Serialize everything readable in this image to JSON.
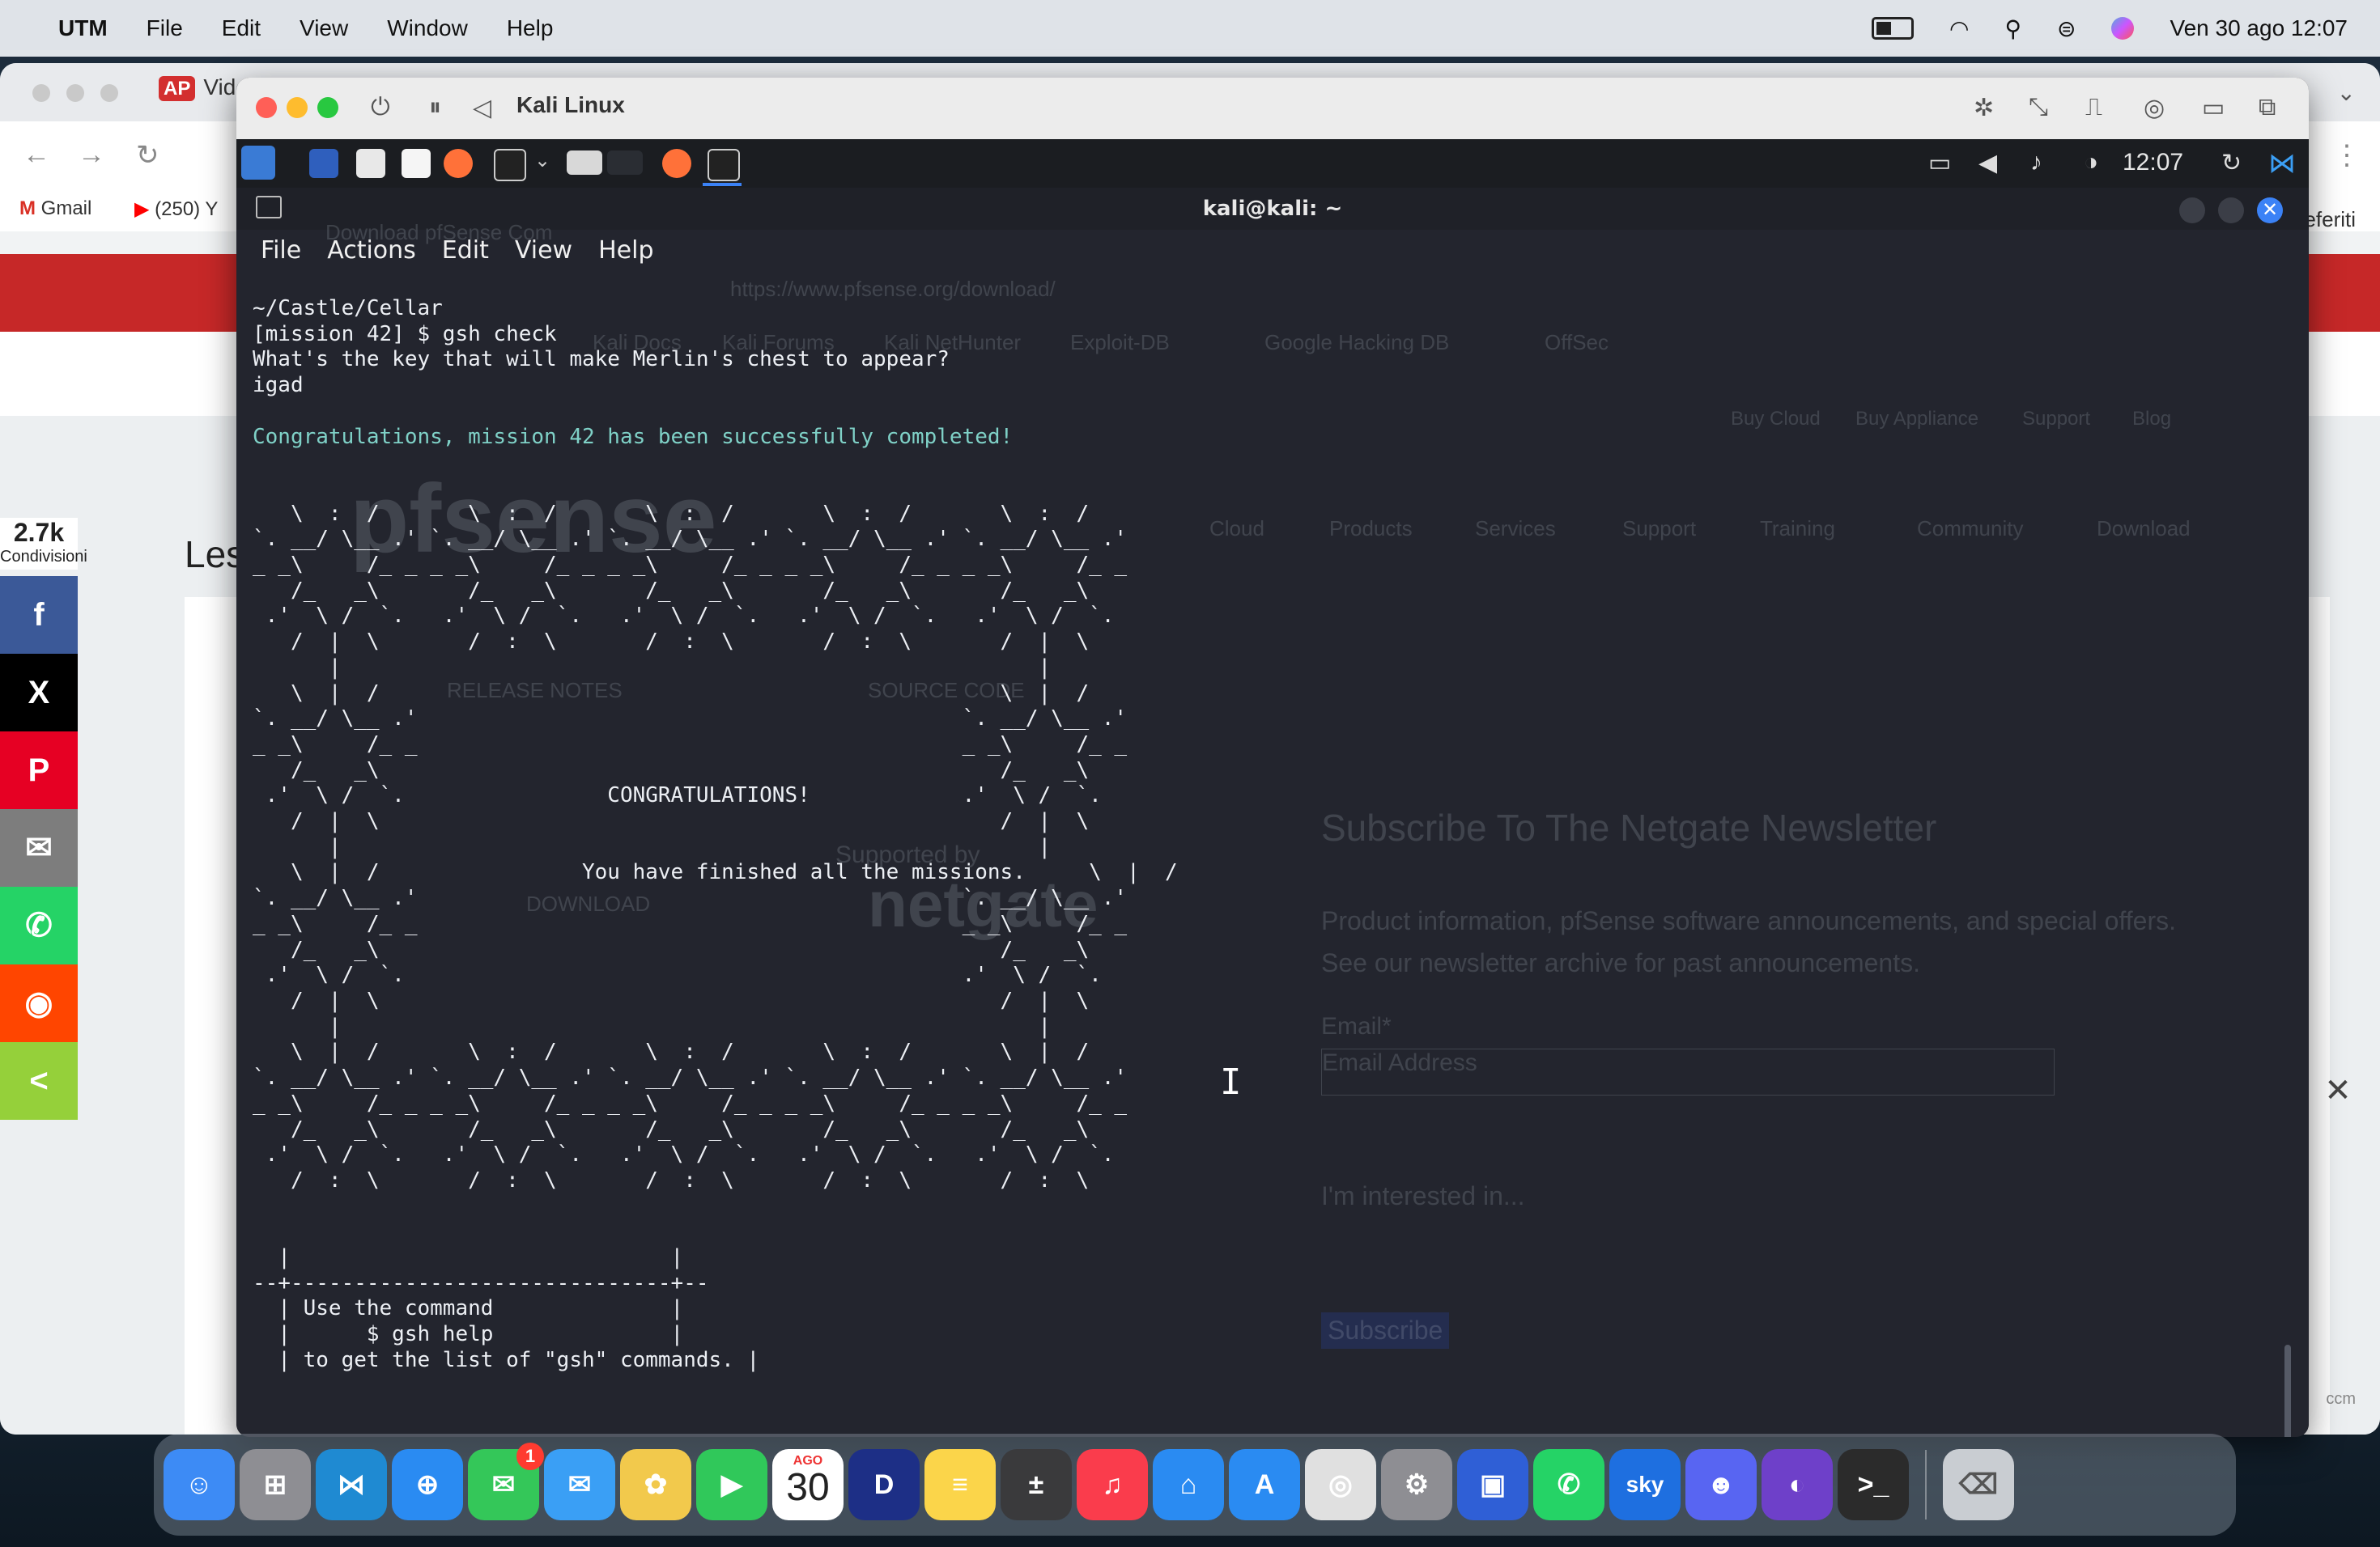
{
  "menubar": {
    "app": "UTM",
    "items": [
      "File",
      "Edit",
      "View",
      "Window",
      "Help"
    ],
    "datetime": "Ven 30 ago 12:07"
  },
  "browser": {
    "tab_title": "Vide",
    "tab_badge": "AP",
    "bookmarks": [
      {
        "label": "Gmail"
      },
      {
        "label": "(250) Y"
      }
    ],
    "right_label": "eferiti",
    "page_heading": "Les",
    "footer_label": "ccm",
    "ghost_url": "https://www.pfsense.org/download/",
    "ghost_bookmarks": [
      "Kali Docs",
      "Kali Forums",
      "Kali NetHunter",
      "Exploit-DB",
      "Google Hacking DB",
      "OffSec"
    ],
    "ghost_links": [
      "Buy Cloud",
      "Buy Appliance",
      "Support",
      "Blog"
    ],
    "ghost_nav": [
      "Cloud",
      "Products",
      "Services",
      "Support",
      "Training",
      "Community",
      "Download"
    ],
    "ghost_tab": "Download pfSense Com",
    "ghost_newsletter": "Subscribe To The Netgate Newsletter",
    "ghost_newsletter_text": "Product information, pfSense software announcements, and special offers. See our newsletter archive for past announcements.",
    "ghost_email_label": "Email*",
    "ghost_email_placeholder": "Email Address",
    "ghost_interest": "I'm interested in...",
    "ghost_subscribe": "Subscribe",
    "ghost_release": "RELEASE NOTES",
    "ghost_source": "SOURCE CODE",
    "ghost_download": "DOWNLOAD",
    "ghost_supported": "Supported by",
    "ghost_netgate": "netgate",
    "ghost_pfsense": "pfsense"
  },
  "share": {
    "count": "2.7k",
    "count_label": "Condivisioni",
    "buttons": [
      {
        "name": "facebook",
        "glyph": "f",
        "color": "#3b5998"
      },
      {
        "name": "x",
        "glyph": "X",
        "color": "#000000"
      },
      {
        "name": "pinterest",
        "glyph": "P",
        "color": "#e60023"
      },
      {
        "name": "email",
        "glyph": "✉",
        "color": "#7d7d7d"
      },
      {
        "name": "whatsapp",
        "glyph": "✆",
        "color": "#25d366"
      },
      {
        "name": "reddit",
        "glyph": "◉",
        "color": "#ff4500"
      },
      {
        "name": "share",
        "glyph": "<",
        "color": "#95d03a"
      }
    ]
  },
  "utm": {
    "vm_title": "Kali Linux",
    "panel_clock": "12:07"
  },
  "terminal": {
    "title": "kali@kali: ~",
    "menu": [
      "File",
      "Actions",
      "Edit",
      "View",
      "Help"
    ],
    "lines": [
      "~/Castle/Cellar",
      "[mission 42] $ gsh check",
      "What's the key that will make Merlin's chest to appear?",
      "igad",
      "",
      "Congratulations, mission 42 has been successfully completed!",
      "",
      "",
      "   \\  :  /       \\  :  /       \\  :  /       \\  :  /       \\  :  /",
      "`. __/ \\__ .' `. __/ \\__ .' `. __/ \\__ .' `. __/ \\__ .' `. __/ \\__ .'",
      "_ _\\     /_ _ _ _\\     /_ _ _ _\\     /_ _ _ _\\     /_ _ _ _\\     /_ _",
      "   /_   _\\       /_   _\\       /_   _\\       /_   _\\       /_   _\\",
      " .'  \\ /  `.   .'  \\ /  `.   .'  \\ /  `.   .'  \\ /  `.   .'  \\ /  `.",
      "   /  |  \\       /  :  \\       /  :  \\       /  :  \\       /  |  \\",
      "      |                                                       |",
      "   \\  |  /                                                 \\  |  /",
      "`. __/ \\__ .'                                           `. __/ \\__ .'",
      "_ _\\     /_ _                                           _ _\\     /_ _",
      "   /_   _\\                                                 /_   _\\",
      " .'  \\ /  `.                CONGRATULATIONS!            .'  \\ /  `.",
      "   /  |  \\                                                 /  |  \\",
      "      |                                                       |",
      "   \\  |  /                You have finished all the missions.     \\  |  /",
      "`. __/ \\__ .'                                           `. __/ \\__ .'",
      "_ _\\     /_ _                                           _ _\\     /_ _",
      "   /_   _\\                                                 /_   _\\",
      " .'  \\ /  `.                                            .'  \\ /  `.",
      "   /  |  \\                                                 /  |  \\",
      "      |                                                       |",
      "   \\  |  /       \\  :  /       \\  :  /       \\  :  /       \\  |  /",
      "`. __/ \\__ .' `. __/ \\__ .' `. __/ \\__ .' `. __/ \\__ .' `. __/ \\__ .'",
      "_ _\\     /_ _ _ _\\     /_ _ _ _\\     /_ _ _ _\\     /_ _ _ _\\     /_ _",
      "   /_   _\\       /_   _\\       /_   _\\       /_   _\\       /_   _\\",
      " .'  \\ /  `.   .'  \\ /  `.   .'  \\ /  `.   .'  \\ /  `.   .'  \\ /  `.",
      "   /  :  \\       /  :  \\       /  :  \\       /  :  \\       /  :  \\",
      "",
      "",
      "  |                              |",
      "--+------------------------------+--",
      "  | Use the command              |",
      "  |      $ gsh help              |",
      "  | to get the list of \"gsh\" commands. |"
    ],
    "success_line_index": 5
  },
  "dock": {
    "calendar_month": "AGO",
    "calendar_day": "30",
    "messages_badge": "1",
    "apps": [
      {
        "name": "finder",
        "color": "#3d8bf5",
        "glyph": "☺"
      },
      {
        "name": "launchpad",
        "color": "#8e8e93",
        "glyph": "⊞"
      },
      {
        "name": "vscode",
        "color": "#1f8ad2",
        "glyph": "⋈"
      },
      {
        "name": "safari",
        "color": "#2a8bf2",
        "glyph": "⊕"
      },
      {
        "name": "messages",
        "color": "#34c759",
        "glyph": "✉"
      },
      {
        "name": "mail",
        "color": "#3a9ff5",
        "glyph": "✉"
      },
      {
        "name": "photos",
        "color": "#f2c94c",
        "glyph": "✿"
      },
      {
        "name": "facetime",
        "color": "#30c85a",
        "glyph": "▶"
      },
      {
        "name": "calendar",
        "color": "#ffffff",
        "glyph": ""
      },
      {
        "name": "disney-plus",
        "color": "#1d2f86",
        "glyph": "D"
      },
      {
        "name": "notes",
        "color": "#fbd54a",
        "glyph": "≡"
      },
      {
        "name": "calculator",
        "color": "#3a3a3c",
        "glyph": "±"
      },
      {
        "name": "music",
        "color": "#fa3c4c",
        "glyph": "♫"
      },
      {
        "name": "keynote",
        "color": "#2a8bf2",
        "glyph": "⌂"
      },
      {
        "name": "app-store",
        "color": "#2a8bf2",
        "glyph": "A"
      },
      {
        "name": "chrome",
        "color": "#e0e0e0",
        "glyph": "◎"
      },
      {
        "name": "system-settings",
        "color": "#8e8e93",
        "glyph": "⚙"
      },
      {
        "name": "utm",
        "color": "#2f5fd6",
        "glyph": "▣"
      },
      {
        "name": "whatsapp",
        "color": "#25d366",
        "glyph": "✆"
      },
      {
        "name": "sky-go",
        "color": "#1e6fe0",
        "glyph": "sky"
      },
      {
        "name": "discord",
        "color": "#5865f2",
        "glyph": "☻"
      },
      {
        "name": "github-desktop",
        "color": "#6e40c9",
        "glyph": "◐"
      },
      {
        "name": "terminal",
        "color": "#2b2b2b",
        "glyph": ">_"
      }
    ],
    "trash": {
      "name": "trash",
      "color": "#c9cdd2",
      "glyph": "⌫"
    }
  }
}
